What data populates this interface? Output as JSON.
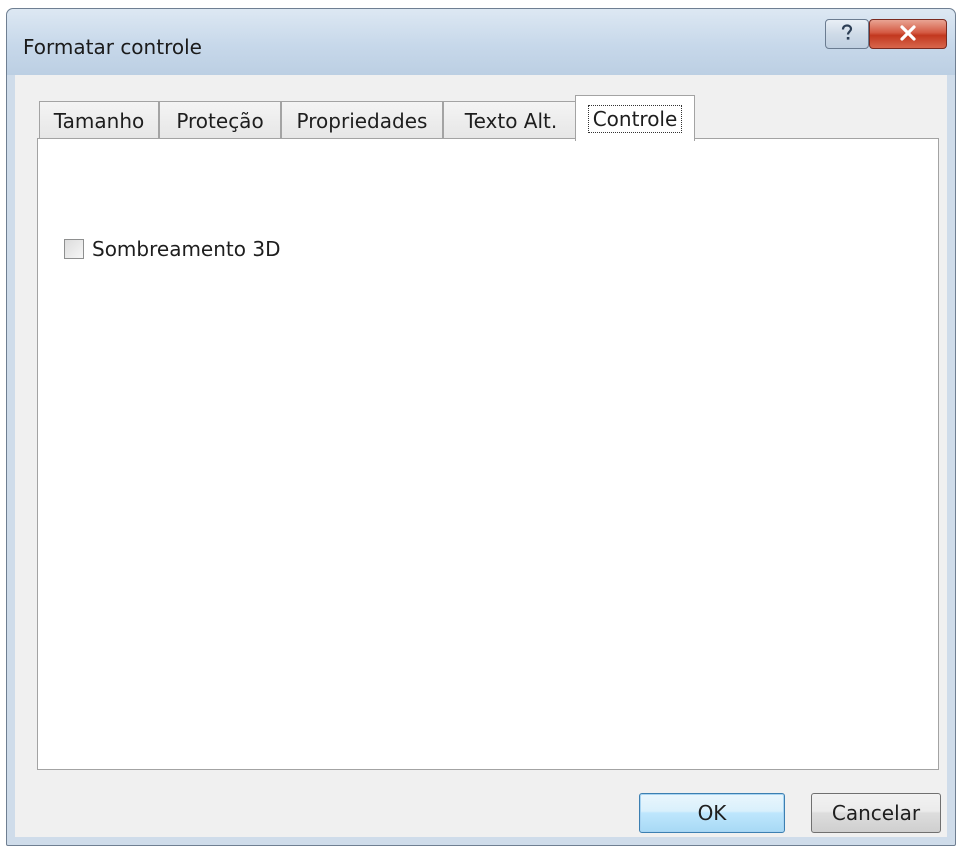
{
  "window": {
    "title": "Formatar controle",
    "help_icon": "question-mark-icon",
    "close_icon": "close-x-icon"
  },
  "tabs": [
    {
      "label": "Tamanho",
      "active": false
    },
    {
      "label": "Proteção",
      "active": false
    },
    {
      "label": "Propriedades",
      "active": false
    },
    {
      "label": "Texto Alt.",
      "active": false
    },
    {
      "label": "Controle",
      "active": true
    }
  ],
  "panel": {
    "checkbox_label": "Sombreamento 3D",
    "checkbox_checked": false
  },
  "footer": {
    "ok_label": "OK",
    "cancel_label": "Cancelar"
  },
  "colors": {
    "close_button": "#c2381f",
    "default_button_accent": "#3c7fb1"
  }
}
